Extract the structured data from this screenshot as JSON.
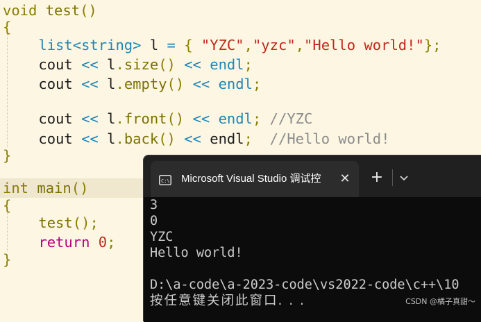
{
  "editor": {
    "lines": [
      {
        "parts": [
          [
            "kw",
            "void"
          ],
          [
            "plain",
            " "
          ],
          [
            "fn",
            "test"
          ],
          [
            "paren",
            "()"
          ]
        ]
      },
      {
        "parts": [
          [
            "brace",
            "{"
          ]
        ]
      },
      {
        "parts": [
          [
            "plain",
            "    "
          ],
          [
            "ty",
            "list"
          ],
          [
            "op",
            "<"
          ],
          [
            "ty",
            "string"
          ],
          [
            "op",
            "> "
          ],
          [
            "plain",
            "l "
          ],
          [
            "op",
            "= "
          ],
          [
            "brace",
            "{ "
          ],
          [
            "str",
            "\"YZC\""
          ],
          [
            "punct",
            ","
          ],
          [
            "str",
            "\"yzc\""
          ],
          [
            "punct",
            ","
          ],
          [
            "str",
            "\"Hello world!\""
          ],
          [
            "brace",
            "}"
          ],
          [
            "punct",
            ";"
          ]
        ]
      },
      {
        "parts": [
          [
            "plain",
            "    "
          ],
          [
            "plain",
            "cout "
          ],
          [
            "op",
            "<< "
          ],
          [
            "plain",
            "l"
          ],
          [
            "punct",
            "."
          ],
          [
            "fn",
            "size"
          ],
          [
            "paren",
            "() "
          ],
          [
            "op",
            "<< "
          ],
          [
            "ty",
            "endl"
          ],
          [
            "punct",
            ";"
          ]
        ]
      },
      {
        "parts": [
          [
            "plain",
            "    "
          ],
          [
            "plain",
            "cout "
          ],
          [
            "op",
            "<< "
          ],
          [
            "plain",
            "l"
          ],
          [
            "punct",
            "."
          ],
          [
            "fn",
            "empty"
          ],
          [
            "paren",
            "() "
          ],
          [
            "op",
            "<< "
          ],
          [
            "ty",
            "endl"
          ],
          [
            "punct",
            ";"
          ]
        ]
      },
      {
        "parts": [
          [
            "plain",
            "    "
          ],
          [
            "plain",
            "cout "
          ],
          [
            "op",
            "<< "
          ],
          [
            "plain",
            "l"
          ],
          [
            "punct",
            "."
          ],
          [
            "fn",
            "front"
          ],
          [
            "paren",
            "() "
          ],
          [
            "op",
            "<< "
          ],
          [
            "ty",
            "endl"
          ],
          [
            "punct",
            "; "
          ],
          [
            "cm",
            "//YZC"
          ]
        ]
      },
      {
        "parts": [
          [
            "plain",
            "    "
          ],
          [
            "plain",
            "cout "
          ],
          [
            "op",
            "<< "
          ],
          [
            "plain",
            "l"
          ],
          [
            "punct",
            "."
          ],
          [
            "fn",
            "back"
          ],
          [
            "paren",
            "() "
          ],
          [
            "op",
            "<< "
          ],
          [
            "plain",
            "endl"
          ],
          [
            "punct",
            ";  "
          ],
          [
            "cm",
            "//Hello world!"
          ]
        ]
      },
      {
        "parts": [
          [
            "brace",
            "}"
          ]
        ]
      },
      {
        "parts": [
          [
            "kw",
            "int"
          ],
          [
            "plain",
            " "
          ],
          [
            "fn",
            "main"
          ],
          [
            "paren",
            "()"
          ]
        ]
      },
      {
        "parts": [
          [
            "brace",
            "{"
          ]
        ]
      },
      {
        "parts": [
          [
            "plain",
            "    "
          ],
          [
            "fn",
            "test"
          ],
          [
            "paren",
            "()"
          ],
          [
            "punct",
            ";"
          ]
        ]
      },
      {
        "parts": [
          [
            "plain",
            "    "
          ],
          [
            "kw2",
            "return"
          ],
          [
            "plain",
            " "
          ],
          [
            "num",
            "0"
          ],
          [
            "punct",
            ";"
          ]
        ]
      },
      {
        "parts": [
          [
            "brace",
            "}"
          ]
        ]
      }
    ]
  },
  "terminal": {
    "tab_title": "Microsoft Visual Studio 调试控",
    "close_glyph": "✕",
    "new_tab_glyph": "+",
    "output": [
      "3",
      "0",
      "YZC",
      "Hello world!",
      "",
      "D:\\a-code\\a-2023-code\\vs2022-code\\c++\\10",
      "按任意键关闭此窗口. . ."
    ]
  },
  "watermark": "CSDN @橘子真甜～"
}
